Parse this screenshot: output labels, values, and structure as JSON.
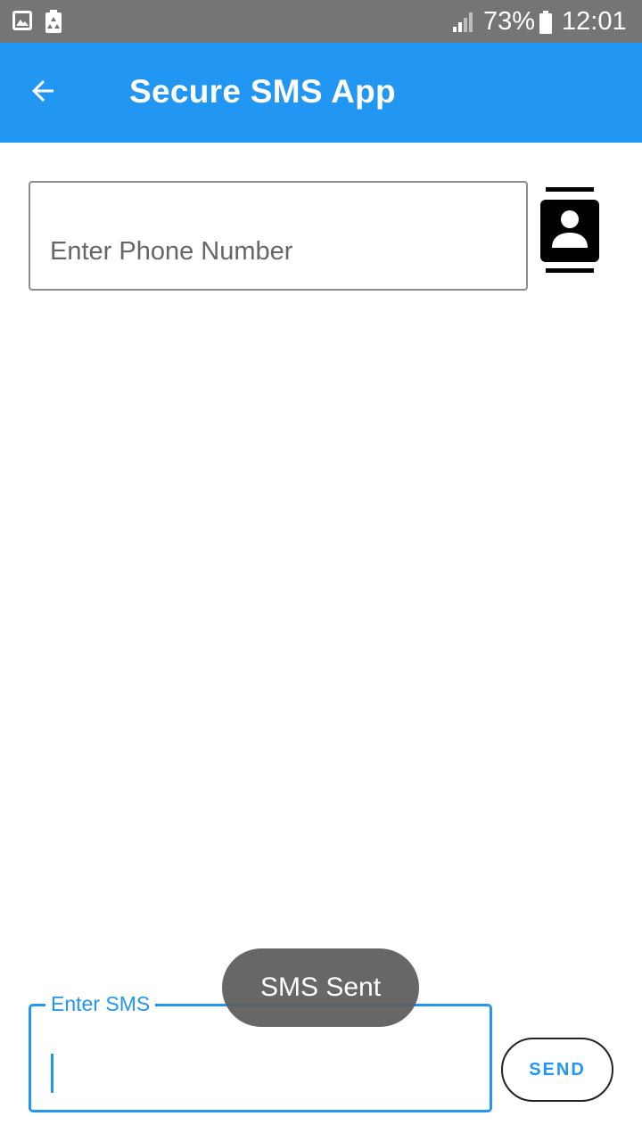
{
  "status_bar": {
    "battery_percent": "73%",
    "time": "12:01",
    "icons": [
      "gallery-icon",
      "recycle-icon",
      "signal-icon",
      "battery-icon"
    ]
  },
  "app_bar": {
    "title": "Secure SMS App",
    "back_icon": "arrow-left-icon",
    "background_color": "#2196f3"
  },
  "phone_field": {
    "placeholder": "Enter Phone Number",
    "value": "",
    "contacts_icon": "contacts-icon"
  },
  "sms_field": {
    "label": "Enter SMS",
    "value": ""
  },
  "send_button": {
    "label": "SEND"
  },
  "toast": {
    "message": "SMS Sent"
  },
  "colors": {
    "accent": "#2196f3",
    "status_bar": "#757575"
  }
}
